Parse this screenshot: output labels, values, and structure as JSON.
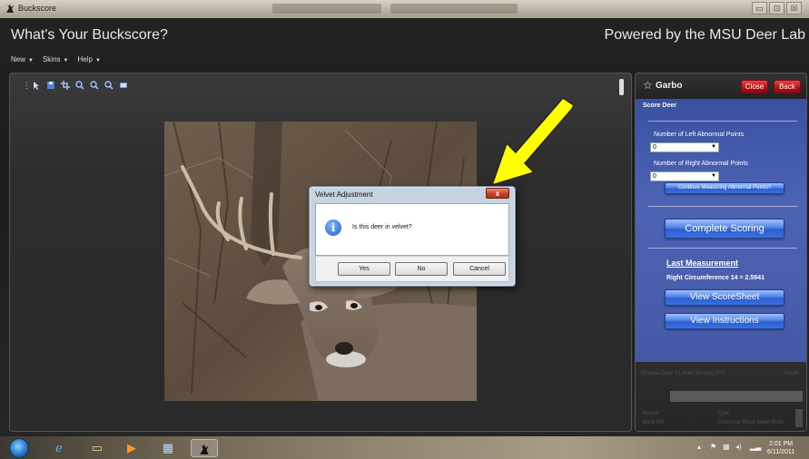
{
  "window": {
    "title": "Buckscore",
    "minimize_glyph": "▭",
    "maximize_glyph": "⊡",
    "close_glyph": "☒"
  },
  "header": {
    "title": "What's Your Buckscore?",
    "powered_by": "Powered by the MSU Deer Lab"
  },
  "menu": {
    "items": [
      {
        "label": "New",
        "caret": "▼"
      },
      {
        "label": "Skins",
        "caret": "▼"
      },
      {
        "label": "Help",
        "caret": "▼"
      }
    ]
  },
  "toolbar": {
    "icons": [
      "grip-icon",
      "pointer-icon",
      "save-icon",
      "crop-icon",
      "zoom-in-icon",
      "zoom-out-icon",
      "zoom-fit-icon",
      "image-icon"
    ]
  },
  "dialog": {
    "title": "Velvet Adjustment",
    "close_glyph": "x",
    "message": "Is this deer in velvet?",
    "icon_glyph": "i",
    "buttons": {
      "yes": "Yes",
      "no": "No",
      "cancel": "Cancel"
    }
  },
  "side_panel": {
    "title": "Garbo",
    "close_label": "Close",
    "back_label": "Back",
    "section": "Score Deer",
    "left_label": "Number of Left Abnormal Points",
    "left_value": "0",
    "right_label": "Number of Right Abnormal Points",
    "right_value": "0",
    "continue_label": "Continue Measuring Abnormal Points?",
    "complete_label": "Complete Scoring",
    "last_title": "Last Measurement",
    "last_value": "Right Circumference 14 = 2.5941",
    "scoresheet_label": "View ScoreSheet",
    "instructions_label": "View Instructions",
    "dim_heading": "Choose Deer To Start Scoring (57)",
    "dim_right": "Squirr",
    "dim_row1_left": "Hunter",
    "dim_row1_right": "Type",
    "dim_row2_left": "Buck Bill",
    "dim_row2_right": "Columbia Black-tailed Buck"
  },
  "taskbar": {
    "time": "2:01 PM",
    "date": "6/11/2011",
    "tray_icons": [
      "▴",
      "⚑",
      "▦",
      "◂)",
      "▂▃"
    ]
  },
  "colors": {
    "accent_blue": "#4559a6",
    "close_red": "#b30f15",
    "arrow_yellow": "#ffff00"
  }
}
